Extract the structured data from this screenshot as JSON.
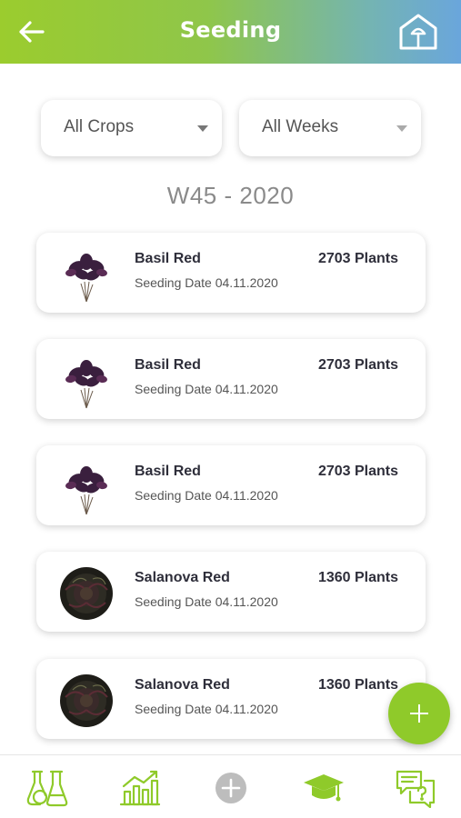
{
  "header": {
    "title": "Seeding",
    "back_icon": "arrow-left-icon",
    "home_icon": "greenhouse-icon"
  },
  "filters": {
    "crops": {
      "selected": "All Crops"
    },
    "weeks": {
      "selected": "All Weeks"
    }
  },
  "week_title": "W45 - 2020",
  "items": [
    {
      "crop": "Basil Red",
      "date": "Seeding Date 04.11.2020",
      "plants": "2703 Plants",
      "image": "basil-red-image"
    },
    {
      "crop": "Basil Red",
      "date": "Seeding Date 04.11.2020",
      "plants": "2703 Plants",
      "image": "basil-red-image"
    },
    {
      "crop": "Basil Red",
      "date": "Seeding Date 04.11.2020",
      "plants": "2703 Plants",
      "image": "basil-red-image"
    },
    {
      "crop": "Salanova Red",
      "date": "Seeding Date 04.11.2020",
      "plants": "1360 Plants",
      "image": "salanova-red-image"
    },
    {
      "crop": "Salanova Red",
      "date": "Seeding Date 04.11.2020",
      "plants": "1360 Plants",
      "image": "salanova-red-image"
    }
  ],
  "fab": {
    "icon": "plus-icon"
  },
  "bottom_nav": [
    {
      "icon": "lab-flasks-icon"
    },
    {
      "icon": "bar-chart-icon"
    },
    {
      "icon": "add-circle-icon"
    },
    {
      "icon": "graduation-cap-icon"
    },
    {
      "icon": "help-chat-icon"
    }
  ],
  "colors": {
    "accent_green": "#8fca2a",
    "header_start": "#9bcc2e",
    "header_end": "#6aa6dc",
    "nav_green": "#8fca2a",
    "nav_grey": "#bdbdbd"
  }
}
